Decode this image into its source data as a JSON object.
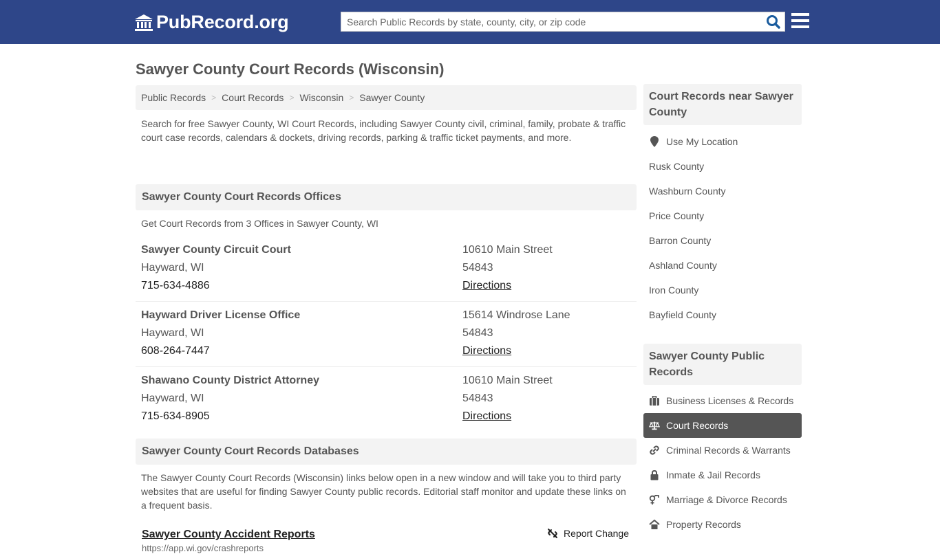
{
  "header": {
    "logo_text": "PubRecord.org",
    "search_placeholder": "Search Public Records by state, county, city, or zip code",
    "search_value": "",
    "brand_color": "#2e4689"
  },
  "page": {
    "title": "Sawyer County Court Records (Wisconsin)"
  },
  "breadcrumb": [
    {
      "label": "Public Records"
    },
    {
      "label": "Court Records"
    },
    {
      "label": "Wisconsin"
    },
    {
      "label": "Sawyer County"
    }
  ],
  "intro": "Search for free Sawyer County, WI Court Records, including Sawyer County civil, criminal, family, probate & traffic court case records, calendars & dockets, driving records, parking & traffic ticket payments, and more.",
  "offices_section": {
    "title": "Sawyer County Court Records Offices",
    "subtitle": "Get Court Records from 3 Offices in Sawyer County, WI",
    "offices": [
      {
        "name": "Sawyer County Circuit Court",
        "city": "Hayward, WI",
        "phone": "715-634-4886",
        "street": "10610 Main Street",
        "zip": "54843",
        "directions": "Directions"
      },
      {
        "name": "Hayward Driver License Office",
        "city": "Hayward, WI",
        "phone": "608-264-7447",
        "street": "15614 Windrose Lane",
        "zip": "54843",
        "directions": "Directions"
      },
      {
        "name": "Shawano County District Attorney",
        "city": "Hayward, WI",
        "phone": "715-634-8905",
        "street": "10610 Main Street",
        "zip": "54843",
        "directions": "Directions"
      }
    ]
  },
  "databases_section": {
    "title": "Sawyer County Court Records Databases",
    "description": "The Sawyer County Court Records (Wisconsin) links below open in a new window and will take you to third party websites that are useful for finding Sawyer County public records. Editorial staff monitor and update these links on a frequent basis.",
    "links": [
      {
        "title": "Sawyer County Accident Reports",
        "url": "https://app.wi.gov/crashreports",
        "report_change": "Report Change"
      }
    ]
  },
  "sidebar_nearby": {
    "title": "Court Records near Sawyer County",
    "use_location": "Use My Location",
    "counties": [
      "Rusk County",
      "Washburn County",
      "Price County",
      "Barron County",
      "Ashland County",
      "Iron County",
      "Bayfield County"
    ]
  },
  "sidebar_public": {
    "title": "Sawyer County Public Records",
    "items": [
      {
        "label": "Business Licenses & Records",
        "icon": "briefcase-icon",
        "active": false
      },
      {
        "label": "Court Records",
        "icon": "scales-icon",
        "active": true
      },
      {
        "label": "Criminal Records & Warrants",
        "icon": "link-icon",
        "active": false
      },
      {
        "label": "Inmate & Jail Records",
        "icon": "lock-icon",
        "active": false
      },
      {
        "label": "Marriage & Divorce Records",
        "icon": "gender-icon",
        "active": false
      },
      {
        "label": "Property Records",
        "icon": "home-icon",
        "active": false
      }
    ]
  }
}
